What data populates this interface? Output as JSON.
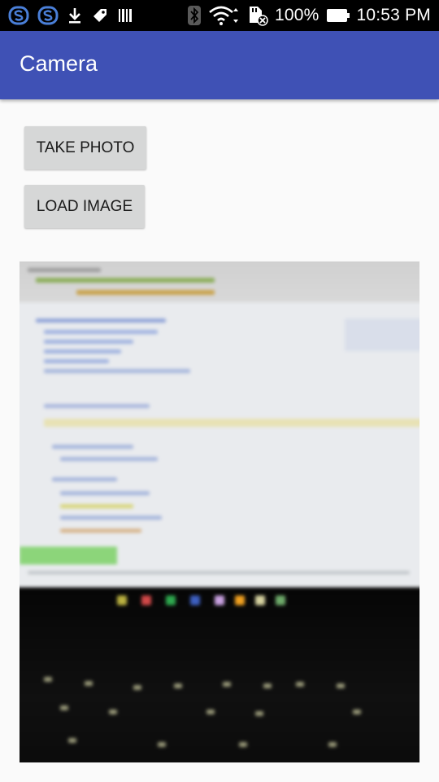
{
  "status_bar": {
    "battery_percent": "100%",
    "time": "10:53 PM",
    "icons_left": [
      "s-app-icon",
      "s-app-icon",
      "download-icon",
      "tag-icon",
      "barcode-icon"
    ],
    "icons_right": [
      "bluetooth-icon",
      "wifi-icon",
      "sd-card-icon",
      "battery-icon"
    ]
  },
  "app_bar": {
    "title": "Camera",
    "color": "#3f51b5"
  },
  "buttons": {
    "take_photo": "TAKE PHOTO",
    "load_image": "LOAD IMAGE"
  },
  "preview": {
    "description_icon": "photo-preview"
  }
}
